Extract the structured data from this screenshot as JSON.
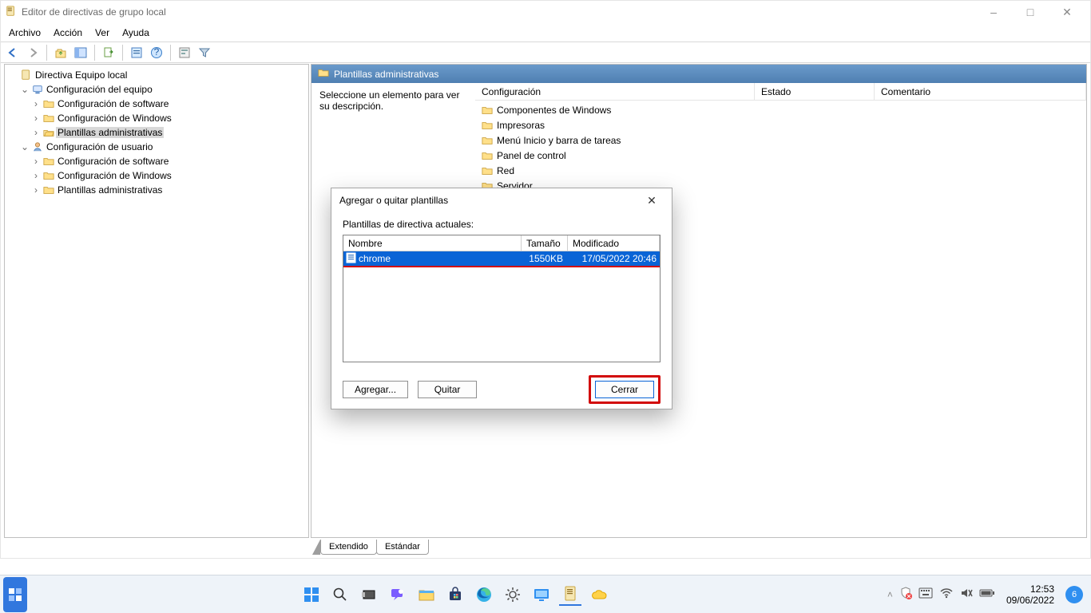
{
  "window": {
    "title": "Editor de directivas de grupo local"
  },
  "menu": {
    "archivo": "Archivo",
    "accion": "Acción",
    "ver": "Ver",
    "ayuda": "Ayuda"
  },
  "tree": {
    "root": "Directiva Equipo local",
    "equipo": "Configuración del equipo",
    "eq_sw": "Configuración de software",
    "eq_win": "Configuración de Windows",
    "eq_adm": "Plantillas administrativas",
    "usuario": "Configuración de usuario",
    "us_sw": "Configuración de software",
    "us_win": "Configuración de Windows",
    "us_adm": "Plantillas administrativas"
  },
  "panel": {
    "title": "Plantillas administrativas",
    "description": "Seleccione un elemento para ver su descripción.",
    "headers": {
      "config": "Configuración",
      "estado": "Estado",
      "coment": "Comentario"
    },
    "items": {
      "i0": "Componentes de Windows",
      "i1": "Impresoras",
      "i2": "Menú Inicio y barra de tareas",
      "i3": "Panel de control",
      "i4": "Red",
      "i5": "Servidor"
    },
    "tabs": {
      "ext": "Extendido",
      "std": "Estándar"
    }
  },
  "dialog": {
    "title": "Agregar o quitar plantillas",
    "subtitle": "Plantillas de directiva actuales:",
    "headers": {
      "name": "Nombre",
      "size": "Tamaño",
      "mod": "Modificado"
    },
    "row": {
      "name": "chrome",
      "size": "1550KB",
      "mod": "17/05/2022 20:46"
    },
    "buttons": {
      "add": "Agregar...",
      "remove": "Quitar",
      "close": "Cerrar"
    }
  },
  "systray": {
    "time": "12:53",
    "date": "09/06/2022",
    "notif_count": "6"
  }
}
